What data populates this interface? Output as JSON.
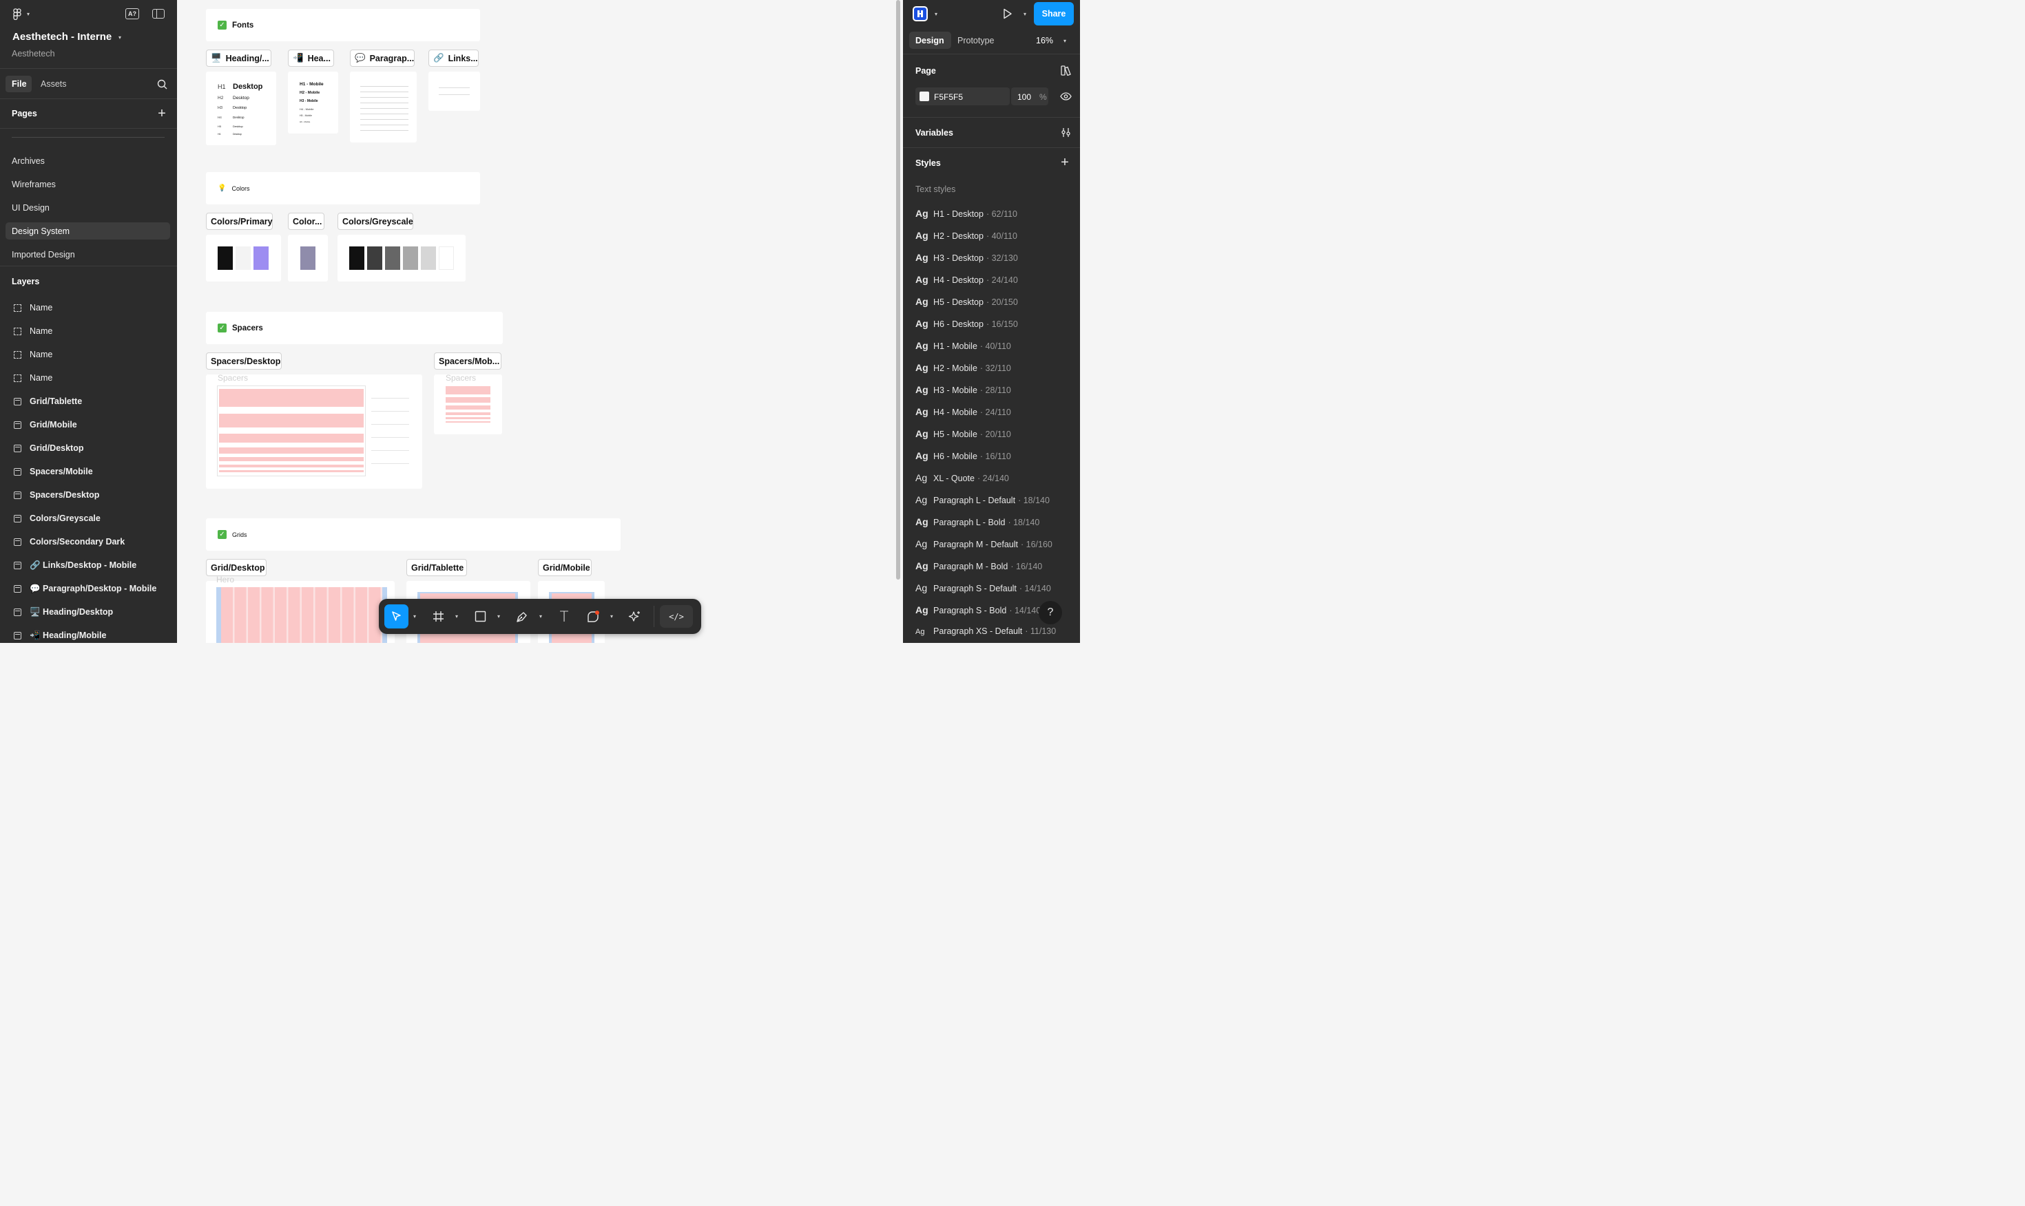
{
  "file": {
    "title": "Aesthetech - Interne",
    "team": "Aesthetech"
  },
  "left_panel": {
    "tabs": [
      "File",
      "Assets"
    ],
    "pages_label": "Pages",
    "pages": [
      "Archives",
      "Wireframes",
      "UI Design",
      "Design System",
      "Imported Design"
    ],
    "active_page": "Design System",
    "layers_label": "Layers",
    "layers": [
      {
        "name": "Name",
        "icon": "dashed-frame-icon"
      },
      {
        "name": "Name",
        "icon": "dashed-frame-icon"
      },
      {
        "name": "Name",
        "icon": "dashed-frame-icon"
      },
      {
        "name": "Name",
        "icon": "dashed-frame-icon"
      },
      {
        "name": "Grid/Tablette",
        "icon": "frame-icon"
      },
      {
        "name": "Grid/Mobile",
        "icon": "frame-icon"
      },
      {
        "name": "Grid/Desktop",
        "icon": "frame-icon"
      },
      {
        "name": "Spacers/Mobile",
        "icon": "frame-icon"
      },
      {
        "name": "Spacers/Desktop",
        "icon": "frame-icon"
      },
      {
        "name": "Colors/Greyscale",
        "icon": "frame-icon"
      },
      {
        "name": "Colors/Secondary Dark",
        "icon": "frame-icon"
      },
      {
        "name": "🔗 Links/Desktop - Mobile",
        "icon": "frame-icon"
      },
      {
        "name": "💬 Paragraph/Desktop - Mobile",
        "icon": "frame-icon"
      },
      {
        "name": "🖥️ Heading/Desktop",
        "icon": "frame-icon"
      },
      {
        "name": "📲 Heading/Mobile",
        "icon": "frame-icon"
      }
    ]
  },
  "canvas": {
    "fonts": {
      "header": "Fonts",
      "tags": [
        "Heading/...",
        "Hea...",
        "Paragrap...",
        "Links..."
      ],
      "tag_icons": [
        "🖥️",
        "📲",
        "💬",
        "🔗"
      ],
      "heading_desktop": [
        {
          "h": "H1",
          "label": "Desktop"
        },
        {
          "h": "H2",
          "label": "Desktop"
        },
        {
          "h": "H3",
          "label": "Desktop"
        },
        {
          "h": "H4",
          "label": "Desktop"
        },
        {
          "h": "H5",
          "label": "Desktop"
        },
        {
          "h": "H6",
          "label": "Desktop"
        }
      ],
      "heading_mobile": [
        "H1 - Mobile",
        "H2 - Mobile",
        "H3 - Mobile",
        "H4 - Mobile",
        "H5 - Mobile",
        "H6 - Mobile"
      ]
    },
    "colors": {
      "header": "Colors",
      "header_icon": "💡",
      "tags": [
        "Colors/Primary",
        "Color...",
        "Colors/Greyscale"
      ],
      "primary": [
        "#111111",
        "#f3f3f3",
        "#9d8df1"
      ],
      "secondary": [
        "#8f8cab"
      ],
      "greyscale": [
        "#111111",
        "#3d3d3d",
        "#666666",
        "#a8a8a8",
        "#d6d6d6",
        "#ffffff"
      ]
    },
    "spacers": {
      "header": "Spacers",
      "tags": [
        "Spacers/Desktop",
        "Spacers/Mob..."
      ],
      "watermark": "Spacers"
    },
    "grids": {
      "header": "Grids",
      "tags": [
        "Grid/Desktop",
        "Grid/Tablette",
        "Grid/Mobile"
      ],
      "watermark": "Hero"
    }
  },
  "right_panel": {
    "tabs": [
      "Design",
      "Prototype"
    ],
    "zoom": "16%",
    "share_label": "Share",
    "page_label": "Page",
    "page_color": "F5F5F5",
    "page_opacity": "100",
    "percent": "%",
    "variables_label": "Variables",
    "styles_label": "Styles",
    "text_styles_label": "Text styles",
    "text_styles": [
      {
        "name": "H1 - Desktop",
        "meta": "· 62/110"
      },
      {
        "name": "H2 - Desktop",
        "meta": "· 40/110"
      },
      {
        "name": "H3 - Desktop",
        "meta": "· 32/130"
      },
      {
        "name": "H4 - Desktop",
        "meta": "· 24/140"
      },
      {
        "name": "H5 - Desktop",
        "meta": "· 20/150"
      },
      {
        "name": "H6 - Desktop",
        "meta": "· 16/150"
      },
      {
        "name": "H1 - Mobile",
        "meta": "· 40/110"
      },
      {
        "name": "H2 - Mobile",
        "meta": "· 32/110"
      },
      {
        "name": "H3 - Mobile",
        "meta": "· 28/110"
      },
      {
        "name": "H4 - Mobile",
        "meta": "· 24/110"
      },
      {
        "name": "H5 - Mobile",
        "meta": "· 20/110"
      },
      {
        "name": "H6 - Mobile",
        "meta": "· 16/110"
      },
      {
        "name": "XL - Quote",
        "meta": "· 24/140"
      },
      {
        "name": "Paragraph L - Default",
        "meta": "· 18/140"
      },
      {
        "name": "Paragraph L - Bold",
        "meta": "· 18/140"
      },
      {
        "name": "Paragraph M - Default",
        "meta": "· 16/160"
      },
      {
        "name": "Paragraph M - Bold",
        "meta": "· 16/140"
      },
      {
        "name": "Paragraph S - Default",
        "meta": "· 14/140"
      },
      {
        "name": "Paragraph S - Bold",
        "meta": "· 14/140"
      },
      {
        "name": "Paragraph XS - Default",
        "meta": "· 11/130"
      }
    ],
    "ag": "Ag",
    "help": "?"
  },
  "toolbar": {
    "tools": [
      "move-tool",
      "frame-tool",
      "rectangle-tool",
      "pen-tool",
      "text-tool",
      "shape-tool",
      "actions-tool",
      "dev-mode-toggle"
    ],
    "text_glyph": "T",
    "code_glyph": "</>"
  },
  "colors": {
    "accent": "#0d99ff",
    "panel": "#2c2c2c",
    "canvas": "#f5f5f5",
    "check": "#4fb548",
    "spacer_pink": "#fbc8c8"
  }
}
